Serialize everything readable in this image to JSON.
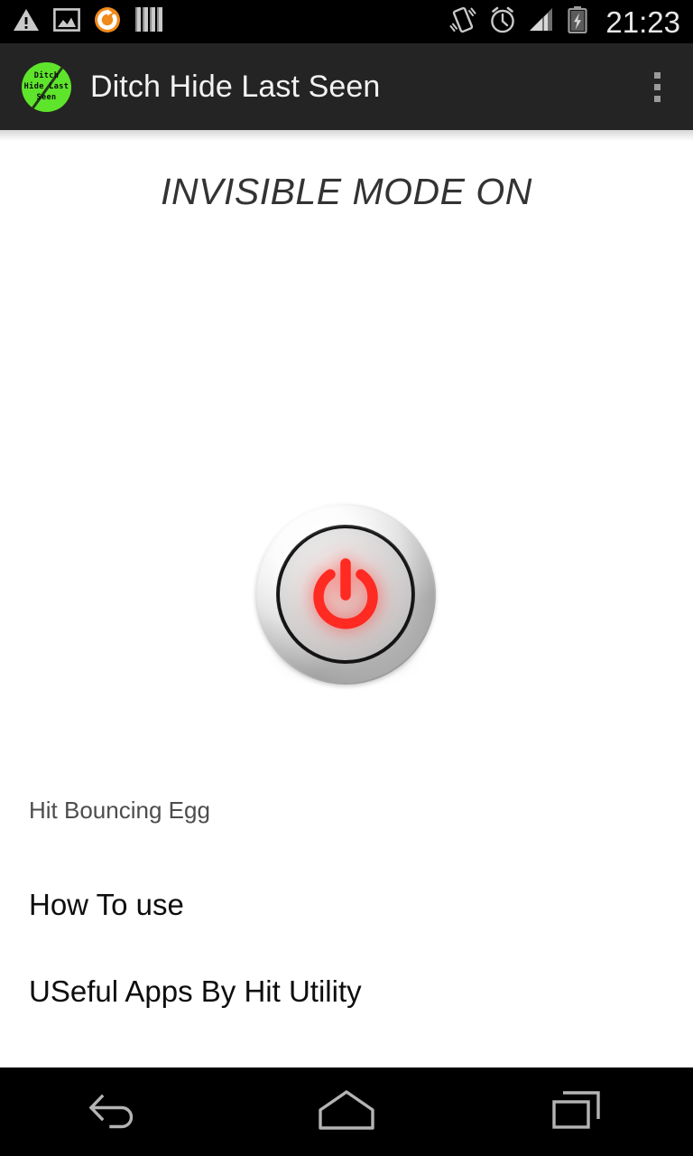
{
  "status_bar": {
    "time": "21:23",
    "left_icons": [
      {
        "name": "warning-icon",
        "label": "Warning"
      },
      {
        "name": "image-icon",
        "label": "Screenshot"
      },
      {
        "name": "sync-circle-icon",
        "label": "Sync"
      },
      {
        "name": "bars-icon",
        "label": "Library"
      }
    ],
    "right_icons": [
      {
        "name": "vibrate-icon",
        "label": "Vibrate"
      },
      {
        "name": "alarm-clock-icon",
        "label": "Alarm"
      },
      {
        "name": "signal-bars-icon",
        "label": "Signal"
      },
      {
        "name": "battery-charging-icon",
        "label": "Battery charging"
      }
    ],
    "colors": {
      "background": "#000000",
      "foreground": "#e8e8e8",
      "accent": "#f08a1a"
    }
  },
  "action_bar": {
    "title": "Ditch Hide Last Seen",
    "app_icon": {
      "name": "app-logo-icon",
      "line1": "Ditch",
      "line2": "Hide Last",
      "line3": "Seen",
      "background": "#5ee52b",
      "text_color": "#0a0a0a"
    },
    "overflow_label": "More options",
    "background": "#242424",
    "title_color": "#f2f2f2"
  },
  "main": {
    "mode_status": "INVISIBLE MODE ON",
    "mode_status_color": "#333333",
    "power_button": {
      "name": "power-toggle-button",
      "state": "on",
      "glyph_color": "#ff2a22",
      "label": "Power toggle"
    },
    "list": [
      {
        "label": "Hit Bouncing Egg",
        "size": "small",
        "name": "list-item-hit-bouncing-egg"
      },
      {
        "label": "How To use",
        "size": "large",
        "name": "list-item-how-to-use"
      },
      {
        "label": "USeful Apps By Hit Utility",
        "size": "large",
        "name": "list-item-useful-apps"
      }
    ],
    "background": "#ffffff"
  },
  "nav_bar": {
    "buttons": [
      {
        "name": "nav-back-button",
        "label": "Back"
      },
      {
        "name": "nav-home-button",
        "label": "Home"
      },
      {
        "name": "nav-recents-button",
        "label": "Recent apps"
      }
    ],
    "background": "#000000",
    "icon_color": "#b4b4b4"
  }
}
